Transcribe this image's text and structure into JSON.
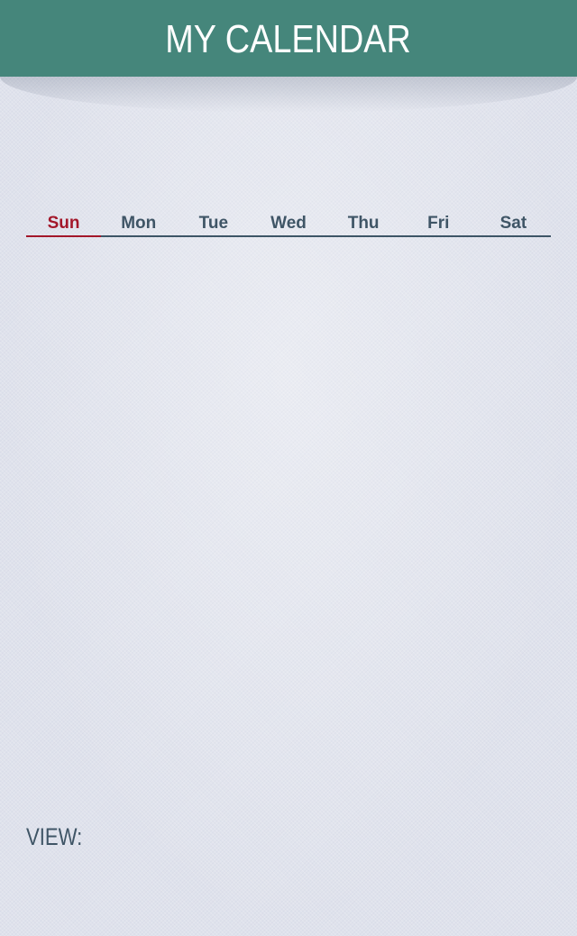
{
  "header": {
    "title": "MY CALENDAR"
  },
  "weekdays": {
    "days": [
      "Sun",
      "Mon",
      "Tue",
      "Wed",
      "Thu",
      "Fri",
      "Sat"
    ],
    "selected": "Sun"
  },
  "footer": {
    "view_label": "VIEW:"
  },
  "colors": {
    "header_bg": "#45867b",
    "accent_red": "#a3172a",
    "text_slate": "#3f5566",
    "page_bg": "#dfe2ec"
  }
}
